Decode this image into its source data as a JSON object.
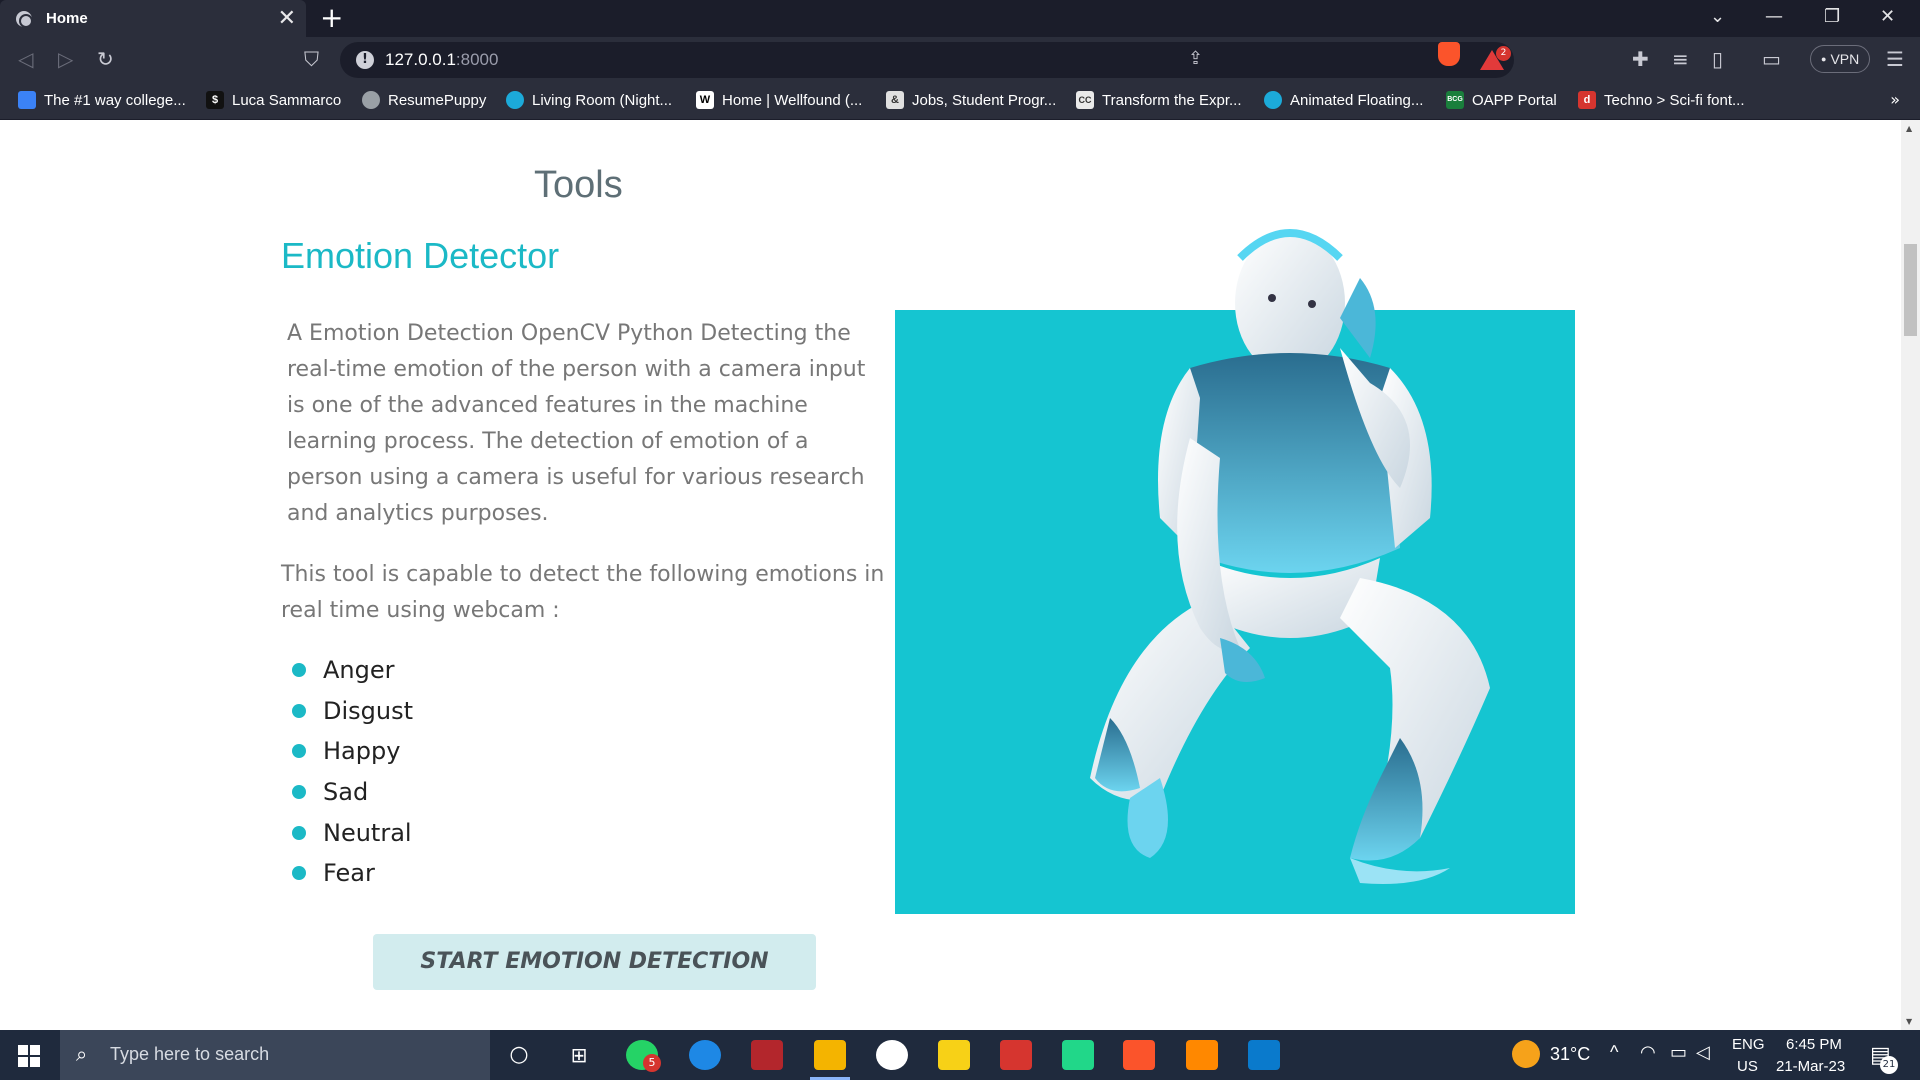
{
  "browser": {
    "tab_title": "Home",
    "tab_close": "✕",
    "new_tab": "+",
    "url_host": "127.0.0.1",
    "url_port": ":8000",
    "vpn_label": "VPN",
    "shields_badge": "2",
    "bookmarks": [
      {
        "label": "The #1 way college...",
        "icon": "handshake-icon",
        "color": "#3b82f6"
      },
      {
        "label": "Luca Sammarco",
        "icon": "dollar-icon",
        "color": "#111111"
      },
      {
        "label": "ResumePuppy",
        "icon": "globe-icon",
        "color": "#9aa0a6"
      },
      {
        "label": "Living Room (Night...",
        "icon": "sketchfab-icon",
        "color": "#1caad9"
      },
      {
        "label": "Home | Wellfound (...",
        "icon": "wellfound-icon",
        "color": "#ffffff"
      },
      {
        "label": "Jobs, Student Progr...",
        "icon": "ampersand-icon",
        "color": "#e0e0e0"
      },
      {
        "label": "Transform the Expr...",
        "icon": "cc-icon",
        "color": "#eaeaea"
      },
      {
        "label": "Animated Floating...",
        "icon": "sketchfab-icon",
        "color": "#1caad9"
      },
      {
        "label": "OAPP Portal",
        "icon": "bcg-icon",
        "color": "#1a7f3c"
      },
      {
        "label": "Techno > Sci-fi font...",
        "icon": "dafont-icon",
        "color": "#d6352f"
      }
    ],
    "bookmarks_more": "»"
  },
  "page": {
    "section_title": "Tools",
    "tool_heading": "Emotion Detector",
    "tool_description": "A Emotion Detection OpenCV Python Detecting the real-time emotion of the person with a camera input is one of the advanced features in the machine learning process. The detection of emotion of a person using a camera is useful for various research and analytics purposes.",
    "capability_text": "This tool is capable to detect the following emotions in real time using webcam :",
    "emotions": [
      "Anger",
      "Disgust",
      "Happy",
      "Sad",
      "Neutral",
      "Fear"
    ],
    "start_button": "START EMOTION DETECTION",
    "accent_color": "#1bb9c6",
    "hero_bg_color": "#15c5d1"
  },
  "taskbar": {
    "search_placeholder": "Type here to search",
    "whatsapp_badge": "5",
    "weather": "31°C",
    "lang_top": "ENG",
    "lang_bottom": "US",
    "time": "6:45 PM",
    "date": "21-Mar-23",
    "notification_count": "21"
  }
}
